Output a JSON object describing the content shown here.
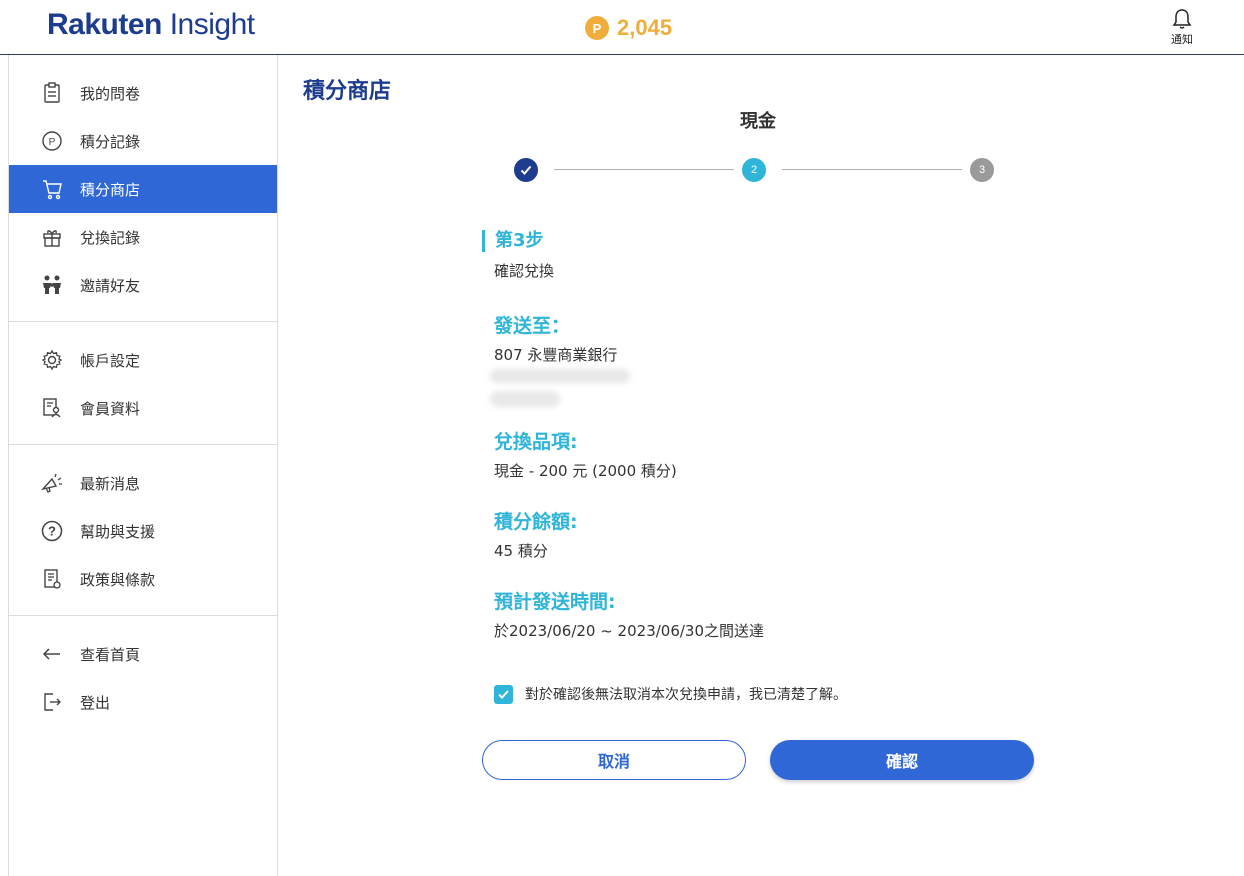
{
  "header": {
    "logo_bold": "Rakuten",
    "logo_light": " Insight",
    "points_badge": "P",
    "points_value": "2,045",
    "notify_label": "通知"
  },
  "sidebar": {
    "groups": [
      [
        {
          "label": "我的問卷",
          "icon": "clipboard-icon"
        },
        {
          "label": "積分記錄",
          "icon": "points-icon"
        },
        {
          "label": "積分商店",
          "icon": "cart-icon",
          "active": true
        },
        {
          "label": "兌換記錄",
          "icon": "gift-icon"
        },
        {
          "label": "邀請好友",
          "icon": "people-icon"
        }
      ],
      [
        {
          "label": "帳戶設定",
          "icon": "gear-icon"
        },
        {
          "label": "會員資料",
          "icon": "profile-doc-icon"
        }
      ],
      [
        {
          "label": "最新消息",
          "icon": "megaphone-icon"
        },
        {
          "label": "幫助與支援",
          "icon": "help-icon"
        },
        {
          "label": "政策與條款",
          "icon": "policy-icon"
        }
      ],
      [
        {
          "label": "查看首頁",
          "icon": "arrow-left-icon"
        },
        {
          "label": "登出",
          "icon": "logout-icon"
        }
      ]
    ]
  },
  "main": {
    "page_title": "積分商店",
    "sub_title": "現金",
    "stepper": {
      "steps": [
        "",
        "2",
        "3"
      ],
      "current": 2
    },
    "step_heading": "第3步",
    "step_desc": "確認兌換",
    "send_to_label": "發送至：",
    "send_to_value": "807 永豐商業銀行",
    "item_label": "兌換品項:",
    "item_value": "現金 - 200 元 (2000 積分)",
    "balance_label": "積分餘額:",
    "balance_value": "45 積分",
    "eta_label": "預計發送時間:",
    "eta_value": "於2023/06/20 ~ 2023/06/30之間送達",
    "agree_text": "對於確認後無法取消本次兌換申請，我已清楚了解。",
    "cancel_label": "取消",
    "confirm_label": "確認"
  },
  "colors": {
    "brand_blue": "#1d3c8f",
    "active_blue": "#2f68d6",
    "accent_cyan": "#2fb5d8",
    "points_gold": "#f0ad3c"
  }
}
